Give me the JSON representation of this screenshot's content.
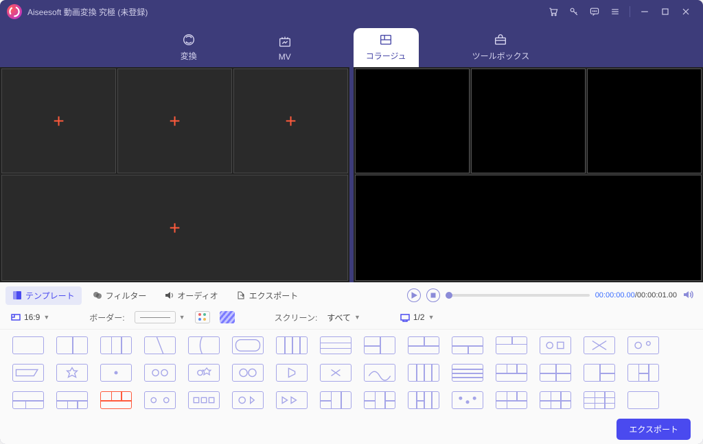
{
  "app": {
    "title": "Aiseesoft 動画変換 究極 (未登録)"
  },
  "nav": {
    "convert": "変換",
    "mv": "MV",
    "collage": "コラージュ",
    "toolbox": "ツールボックス"
  },
  "subtabs": {
    "template": "テンプレート",
    "filter": "フィルター",
    "audio": "オーディオ",
    "export": "エクスポート"
  },
  "options": {
    "ratio": "16:9",
    "border_label": "ボーダー:",
    "screen_label": "スクリーン:",
    "screen_value": "すべて",
    "page": "1/2"
  },
  "playback": {
    "current": "00:00:00.00",
    "duration": "00:00:01.00"
  },
  "footer": {
    "export": "エクスポート"
  }
}
